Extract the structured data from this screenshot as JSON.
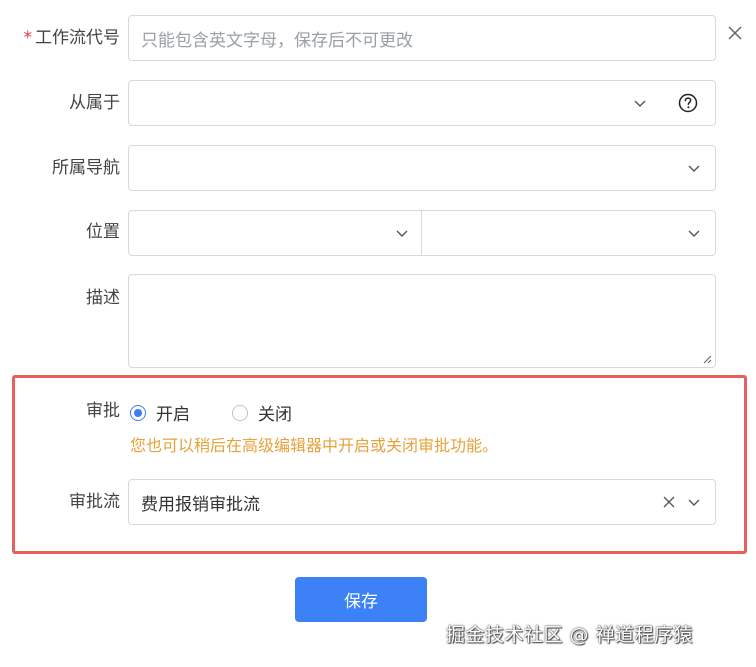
{
  "form": {
    "workflow_code": {
      "label": "工作流代号",
      "required_mark": "*",
      "placeholder": "只能包含英文字母，保存后不可更改",
      "value": ""
    },
    "belongs_to": {
      "label": "从属于",
      "value": ""
    },
    "nav": {
      "label": "所属导航",
      "value": ""
    },
    "position": {
      "label": "位置",
      "first_value": "",
      "second_value": ""
    },
    "description": {
      "label": "描述",
      "value": ""
    },
    "approval": {
      "label": "审批",
      "options": [
        {
          "label": "开启",
          "checked": true
        },
        {
          "label": "关闭",
          "checked": false
        }
      ],
      "hint": "您也可以稍后在高级编辑器中开启或关闭审批功能。"
    },
    "approval_flow": {
      "label": "审批流",
      "value": "费用报销审批流"
    },
    "save_label": "保存"
  },
  "watermark": "掘金技术社区 @ 禅道程序猿",
  "colors": {
    "primary": "#3c82f6",
    "highlight_border": "#e8605a",
    "hint": "#e6a23c",
    "required": "#e23b3b"
  },
  "icons": {
    "close": "close-icon",
    "dropdown": "chevron-down-icon",
    "help": "help-circle-icon",
    "clear": "clear-icon"
  }
}
